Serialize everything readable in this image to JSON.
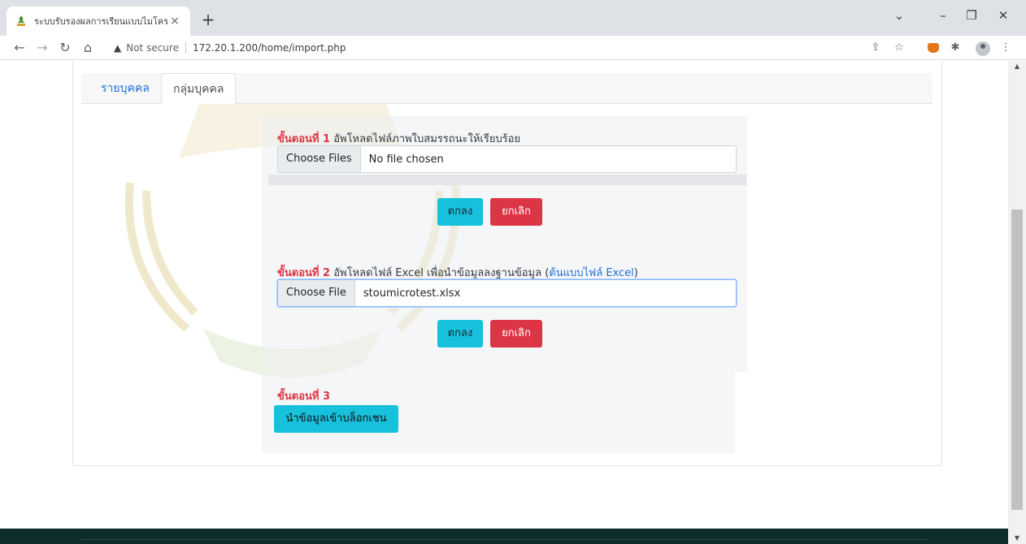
{
  "browser": {
    "tab_title": "ระบบรับรองผลการเรียนแบบไมโคร",
    "tab_close": "×",
    "new_tab": "+",
    "security_label": "Not secure",
    "url": "172.20.1.200/home/import.php"
  },
  "page": {
    "tabs": [
      {
        "label": "รายบุคคล",
        "active": false
      },
      {
        "label": "กลุ่มบุคคล",
        "active": true
      }
    ],
    "step1": {
      "label": "ขั้นตอนที่ 1",
      "text": " อัพโหลดไฟล์ภาพใบสมรรถนะให้เรียบร้อย",
      "file_button": "Choose Files",
      "file_status": "No file chosen",
      "ok": "ตกลง",
      "cancel": "ยกเลิก"
    },
    "step2": {
      "label": "ขั้นตอนที่ 2",
      "text": " อัพโหลดไฟล์ Excel เพื่อนำข้อมูลลงฐานข้อมูล (",
      "link": "ต้นแบบไฟล์ Excel",
      "text_end": ")",
      "file_button": "Choose File",
      "file_status": "stoumicrotest.xlsx",
      "ok": "ตกลง",
      "cancel": "ยกเลิก"
    },
    "step3": {
      "label": "ขั้นตอนที่ 3",
      "button": "นำข้อมูลเข้าบล็อกเชน"
    }
  },
  "colors": {
    "primary_link": "#1e6fd9",
    "danger": "#dc3545",
    "info": "#17c1dc",
    "footer": "#0f2d2a"
  }
}
